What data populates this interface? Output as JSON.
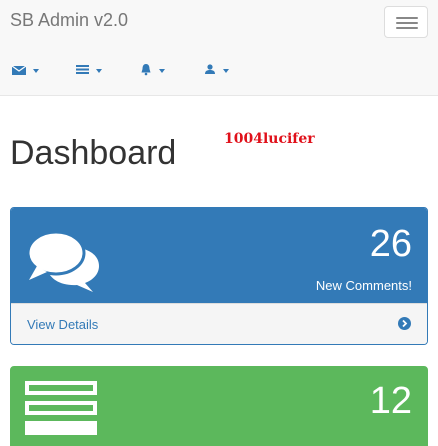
{
  "navbar": {
    "brand": "SB Admin v2.0",
    "toggle_icon": "hamburger-icon",
    "items": [
      {
        "icon": "envelope-icon"
      },
      {
        "icon": "tasks-icon"
      },
      {
        "icon": "bell-icon"
      },
      {
        "icon": "user-icon"
      }
    ]
  },
  "watermark": "1004lucifer",
  "page": {
    "title": "Dashboard"
  },
  "panels": {
    "comments": {
      "icon": "comments-icon",
      "count": "26",
      "label": "New Comments!",
      "link": "View Details",
      "link_icon": "chevron-circle-right-icon",
      "color": "#337ab7"
    },
    "tasks": {
      "icon": "tasks-icon",
      "count": "12",
      "color": "#5cb85c"
    }
  },
  "colors": {
    "primary": "#337ab7",
    "success": "#5cb85c",
    "navbar_bg": "#f8f8f8",
    "watermark": "#e0101a"
  }
}
